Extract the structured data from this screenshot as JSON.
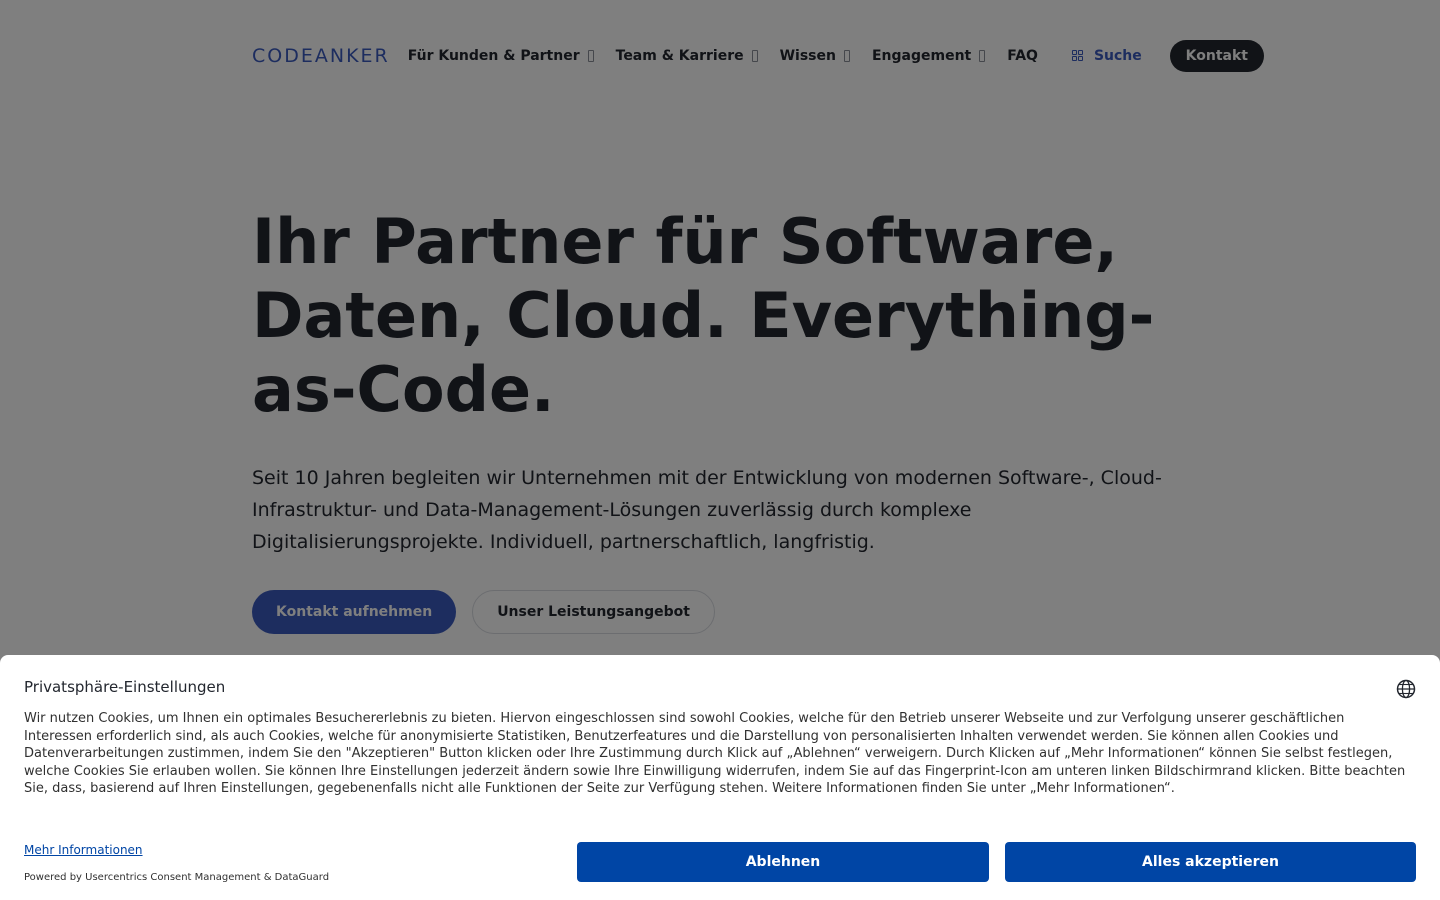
{
  "header": {
    "logo": "CODEANKER",
    "nav": [
      {
        "label": "Für Kunden & Partner",
        "dropdown": true
      },
      {
        "label": "Team & Karriere",
        "dropdown": true
      },
      {
        "label": "Wissen",
        "dropdown": true
      },
      {
        "label": "Engagement",
        "dropdown": true
      },
      {
        "label": "FAQ",
        "dropdown": false
      }
    ],
    "search_label": "Suche",
    "contact_label": "Kontakt"
  },
  "hero": {
    "title": "Ihr Partner für Software, Daten, Cloud. Everything-as-Code.",
    "text": "Seit 10 Jahren begleiten wir Unternehmen mit der Entwicklung von modernen Software-, Cloud-Infrastruktur- und Data-Management-Lösungen zuverlässig durch komplexe Digitalisierungsprojekte. Individuell, partnerschaftlich, langfristig.",
    "cta_primary": "Kontakt aufnehmen",
    "cta_secondary": "Unser Leistungsangebot"
  },
  "consent": {
    "title": "Privatsphäre-Einstellungen",
    "text": "Wir nutzen Cookies, um Ihnen ein optimales Besuchererlebnis zu bieten. Hiervon eingeschlossen sind sowohl Cookies, welche für den Betrieb unserer Webseite und zur Verfolgung unserer geschäftlichen Interessen erforderlich sind, als auch Cookies, welche für anonymisierte Statistiken, Benutzerfeatures und die Darstellung von personalisierten Inhalten verwendet werden. Sie können allen Cookies und Datenverarbeitungen zustimmen, indem Sie den \"Akzeptieren\" Button klicken oder Ihre Zustimmung durch Klick auf „Ablehnen“ verweigern. Durch Klicken auf „Mehr Informationen“ können Sie selbst festlegen, welche Cookies Sie erlauben wollen. Sie können Ihre Einstellungen jederzeit ändern sowie Ihre Einwilligung widerrufen, indem Sie auf das Fingerprint-Icon am unteren linken Bildschirmrand klicken. Bitte beachten Sie, dass, basierend auf Ihren Einstellungen, gegebenenfalls nicht alle Funktionen der Seite zur Verfügung stehen. Weitere Informationen finden Sie unter „Mehr Informationen“.",
    "more_info": "Mehr Informationen",
    "powered_by": "Powered by Usercentrics Consent Management & DataGuard",
    "decline_label": "Ablehnen",
    "accept_label": "Alles akzeptieren"
  },
  "colors": {
    "brand": "#3a5bbf",
    "dark": "#23272f",
    "consent_blue": "#0045a5",
    "overlay": "rgba(0,0,0,0.5)"
  },
  "icons": {
    "dropdown": "chevron-down-icon",
    "search": "grid-search-icon",
    "language": "globe-icon"
  }
}
